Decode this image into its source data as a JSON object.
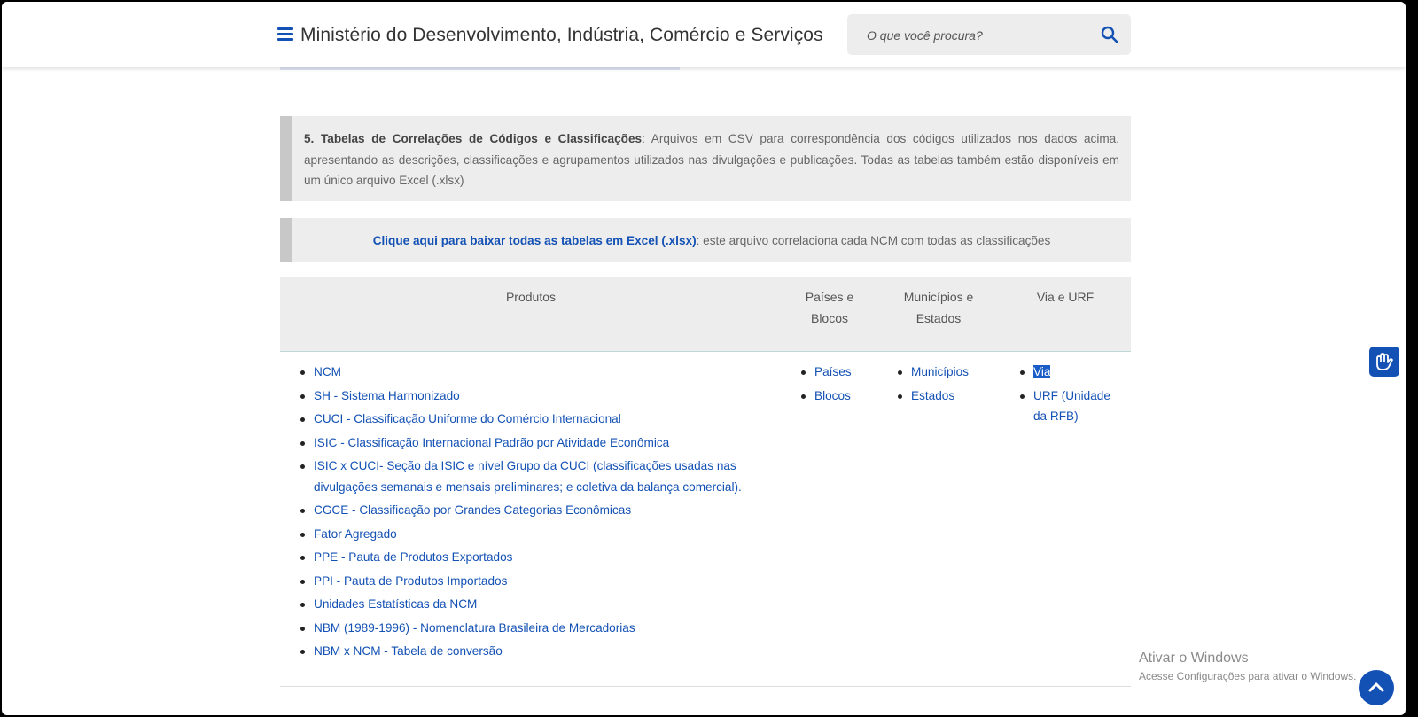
{
  "header": {
    "site_title": "Ministério do Desenvolvimento, Indústria, Comércio e Serviços",
    "search_placeholder": "O que você procura?"
  },
  "section5": {
    "heading": "5. Tabelas de Correlações de Códigos e Classificações",
    "description": ": Arquivos em CSV para correspondência dos códigos utilizados nos dados acima, apresentando as descrições, classificações e agrupamentos utilizados nas divulgações e publicações. Todas as tabelas também estão disponíveis em um único arquivo Excel (.xlsx)",
    "download_link": "Clique aqui para baixar todas as tabelas em Excel (.xlsx)",
    "download_note": ": este arquivo correlaciona cada NCM com todas as classificações"
  },
  "table": {
    "headers": {
      "produtos": "Produtos",
      "paises": "Países e Blocos",
      "municipios": "Municípios e Estados",
      "via": "Via e URF"
    },
    "produtos": [
      "NCM",
      "SH - Sistema Harmonizado",
      "CUCI - Classificação Uniforme do Comércio Internacional",
      "ISIC - Classificação Internacional Padrão por Atividade Econômica",
      "ISIC x CUCI- Seção da ISIC e nível Grupo da CUCI (classificações usadas nas divulgações semanais e mensais preliminares; e coletiva da balança comercial).",
      "CGCE - Classificação por Grandes Categorias Econômicas",
      "Fator Agregado",
      "PPE - Pauta de Produtos Exportados",
      "PPI - Pauta de Produtos Importados",
      "Unidades Estatísticas da NCM",
      "NBM (1989-1996) - Nomenclatura Brasileira de Mercadorias",
      "NBM x NCM - Tabela de conversão"
    ],
    "paises": [
      "Países",
      "Blocos"
    ],
    "municipios": [
      "Municípios",
      "Estados"
    ],
    "via": [
      "Via",
      "URF (Unidade da RFB)"
    ]
  },
  "watermark": {
    "title": "Ativar o Windows",
    "subtitle": "Acesse Configurações para ativar o Windows."
  },
  "colors": {
    "link": "#1351b4",
    "panel": "#ededed",
    "accent_bar": "#c8c8c8"
  },
  "icons": [
    "menu-icon",
    "search-icon",
    "sign-language-icon",
    "chevron-up-icon"
  ]
}
